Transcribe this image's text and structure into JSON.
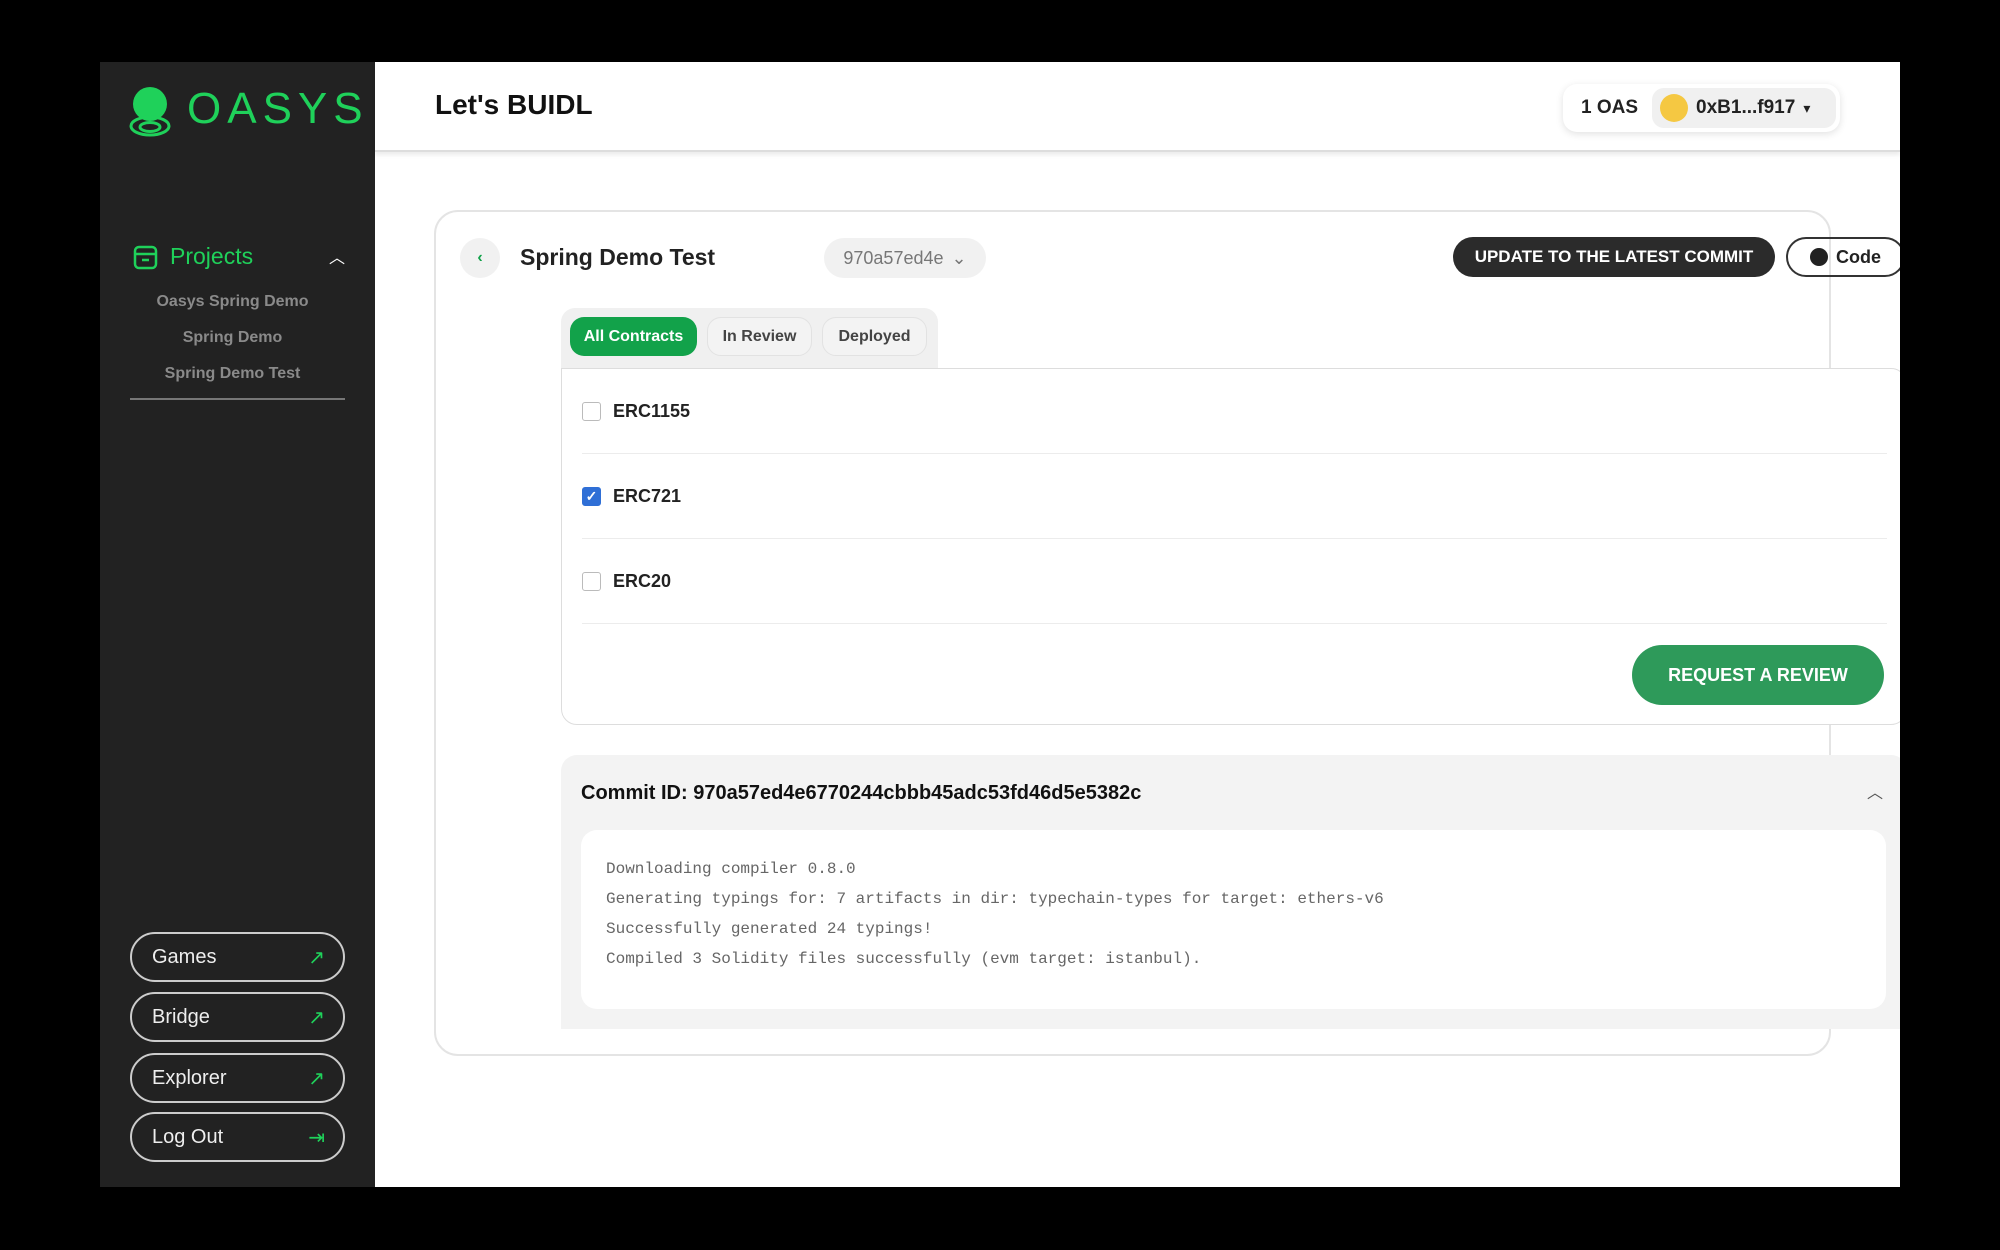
{
  "brand": {
    "name": "OASYS",
    "color": "#1fd15a"
  },
  "sidebar": {
    "section": "Projects",
    "projects": [
      "Oasys Spring Demo",
      "Spring Demo",
      "Spring Demo Test"
    ],
    "links": [
      {
        "label": "Games",
        "icon": "external-link-icon"
      },
      {
        "label": "Bridge",
        "icon": "external-link-icon"
      },
      {
        "label": "Explorer",
        "icon": "external-link-icon"
      },
      {
        "label": "Log Out",
        "icon": "logout-icon"
      }
    ]
  },
  "header": {
    "title": "Let's BUIDL",
    "balance": "1 OAS",
    "address": "0xB1...f917"
  },
  "project": {
    "name": "Spring Demo Test",
    "commit_select": "970a57ed4e",
    "update_button": "UPDATE TO THE LATEST COMMIT",
    "code_button": "Code"
  },
  "tabs": [
    {
      "label": "All Contracts",
      "active": true
    },
    {
      "label": "In Review",
      "active": false
    },
    {
      "label": "Deployed",
      "active": false
    }
  ],
  "contracts": [
    {
      "name": "ERC1155",
      "checked": false
    },
    {
      "name": "ERC721",
      "checked": true
    },
    {
      "name": "ERC20",
      "checked": false
    }
  ],
  "request_button": "REQUEST A REVIEW",
  "commit": {
    "label": "Commit ID: 970a57ed4e6770244cbbb45adc53fd46d5e5382c",
    "log": [
      "Downloading compiler 0.8.0",
      "Generating typings for: 7 artifacts in dir: typechain-types for target: ethers-v6",
      "Successfully generated 24 typings!",
      "Compiled 3 Solidity files successfully (evm target: istanbul)."
    ]
  },
  "colors": {
    "accent": "#12a24a",
    "request": "#2e9a5a",
    "dark": "#2b2b2b",
    "checkbox": "#2f6fd6"
  }
}
